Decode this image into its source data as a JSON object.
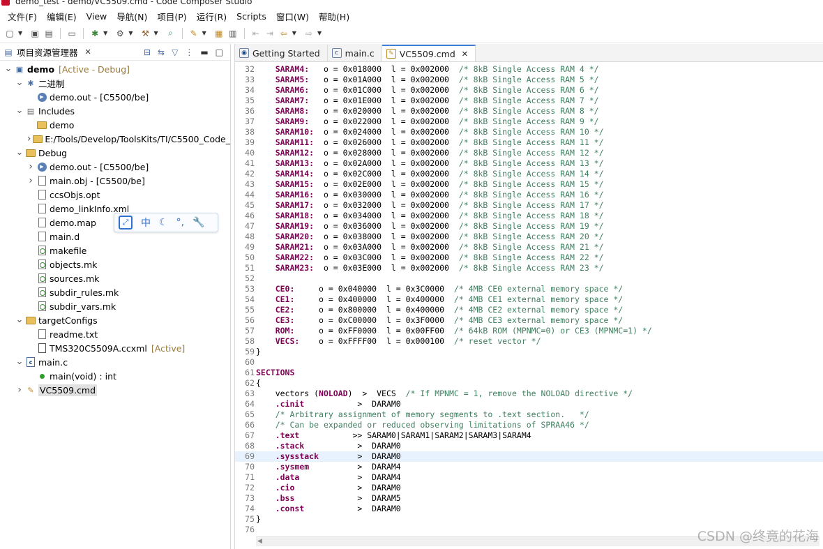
{
  "window": {
    "title": "demo_test - demo/VC5509.cmd - Code Composer Studio"
  },
  "menu": [
    "文件(F)",
    "编辑(E)",
    "View",
    "导航(N)",
    "项目(P)",
    "运行(R)",
    "Scripts",
    "窗口(W)",
    "帮助(H)"
  ],
  "explorer": {
    "title": "项目资源管理器",
    "tree": [
      {
        "label": "demo",
        "decor": "[Active - Debug]",
        "depth": 0,
        "twisty": "down",
        "icon": "project-icon",
        "bold": true
      },
      {
        "label": "二进制",
        "decor": "",
        "depth": 1,
        "twisty": "down",
        "icon": "binaries-icon"
      },
      {
        "label": "demo.out - [C5500/be]",
        "decor": "",
        "depth": 2,
        "twisty": "",
        "icon": "executable-icon"
      },
      {
        "label": "Includes",
        "decor": "",
        "depth": 1,
        "twisty": "down",
        "icon": "includes-icon"
      },
      {
        "label": "demo",
        "decor": "",
        "depth": 2,
        "twisty": "",
        "icon": "include-folder-icon"
      },
      {
        "label": "E:/Tools/Develop/ToolsKits/TI/C5500_Code_",
        "decor": "",
        "depth": 2,
        "twisty": "right",
        "icon": "include-folder-icon"
      },
      {
        "label": "Debug",
        "decor": "",
        "depth": 1,
        "twisty": "down",
        "icon": "folder-icon"
      },
      {
        "label": "demo.out - [C5500/be]",
        "decor": "",
        "depth": 2,
        "twisty": "right",
        "icon": "executable-icon"
      },
      {
        "label": "main.obj - [C5500/be]",
        "decor": "",
        "depth": 2,
        "twisty": "right",
        "icon": "object-file-icon"
      },
      {
        "label": "ccsObjs.opt",
        "decor": "",
        "depth": 2,
        "twisty": "",
        "icon": "file-icon"
      },
      {
        "label": "demo_linkInfo.xml",
        "decor": "",
        "depth": 2,
        "twisty": "",
        "icon": "file-icon"
      },
      {
        "label": "demo.map",
        "decor": "",
        "depth": 2,
        "twisty": "",
        "icon": "file-icon"
      },
      {
        "label": "main.d",
        "decor": "",
        "depth": 2,
        "twisty": "",
        "icon": "file-icon"
      },
      {
        "label": "makefile",
        "decor": "",
        "depth": 2,
        "twisty": "",
        "icon": "makefile-icon"
      },
      {
        "label": "objects.mk",
        "decor": "",
        "depth": 2,
        "twisty": "",
        "icon": "makefile-icon"
      },
      {
        "label": "sources.mk",
        "decor": "",
        "depth": 2,
        "twisty": "",
        "icon": "makefile-icon"
      },
      {
        "label": "subdir_rules.mk",
        "decor": "",
        "depth": 2,
        "twisty": "",
        "icon": "makefile-icon"
      },
      {
        "label": "subdir_vars.mk",
        "decor": "",
        "depth": 2,
        "twisty": "",
        "icon": "makefile-icon"
      },
      {
        "label": "targetConfigs",
        "decor": "",
        "depth": 1,
        "twisty": "down",
        "icon": "folder-icon"
      },
      {
        "label": "readme.txt",
        "decor": "",
        "depth": 2,
        "twisty": "",
        "icon": "file-icon"
      },
      {
        "label": "TMS320C5509A.ccxml",
        "decor": "[Active]",
        "depth": 2,
        "twisty": "",
        "icon": "ccxml-icon"
      },
      {
        "label": "main.c",
        "decor": "",
        "depth": 1,
        "twisty": "down",
        "icon": "c-file-icon"
      },
      {
        "label": "main(void) : int",
        "decor": "",
        "depth": 2,
        "twisty": "",
        "icon": "function-icon"
      },
      {
        "label": "VC5509.cmd",
        "decor": "",
        "depth": 1,
        "twisty": "right",
        "icon": "cmd-file-icon",
        "selected": true
      }
    ]
  },
  "ime": {
    "lang": "中"
  },
  "editor": {
    "tabs": [
      {
        "label": "Getting Started",
        "active": false,
        "closable": false
      },
      {
        "label": "main.c",
        "active": false,
        "closable": false
      },
      {
        "label": "VC5509.cmd",
        "active": true,
        "closable": true
      }
    ],
    "current_line": 69,
    "lines": [
      {
        "n": "32",
        "kw": "SARAM4:",
        "rest": "   o = 0x018000  l = 0x002000  ",
        "cm": "/* 8kB Single Access RAM 4 */"
      },
      {
        "n": "33",
        "kw": "SARAM5:",
        "rest": "   o = 0x01A000  l = 0x002000  ",
        "cm": "/* 8kB Single Access RAM 5 */"
      },
      {
        "n": "34",
        "kw": "SARAM6:",
        "rest": "   o = 0x01C000  l = 0x002000  ",
        "cm": "/* 8kB Single Access RAM 6 */"
      },
      {
        "n": "35",
        "kw": "SARAM7:",
        "rest": "   o = 0x01E000  l = 0x002000  ",
        "cm": "/* 8kB Single Access RAM 7 */"
      },
      {
        "n": "36",
        "kw": "SARAM8:",
        "rest": "   o = 0x020000  l = 0x002000  ",
        "cm": "/* 8kB Single Access RAM 8 */"
      },
      {
        "n": "37",
        "kw": "SARAM9:",
        "rest": "   o = 0x022000  l = 0x002000  ",
        "cm": "/* 8kB Single Access RAM 9 */"
      },
      {
        "n": "38",
        "kw": "SARAM10:",
        "rest": "  o = 0x024000  l = 0x002000  ",
        "cm": "/* 8kB Single Access RAM 10 */"
      },
      {
        "n": "39",
        "kw": "SARAM11:",
        "rest": "  o = 0x026000  l = 0x002000  ",
        "cm": "/* 8kB Single Access RAM 11 */"
      },
      {
        "n": "40",
        "kw": "SARAM12:",
        "rest": "  o = 0x028000  l = 0x002000  ",
        "cm": "/* 8kB Single Access RAM 12 */"
      },
      {
        "n": "41",
        "kw": "SARAM13:",
        "rest": "  o = 0x02A000  l = 0x002000  ",
        "cm": "/* 8kB Single Access RAM 13 */"
      },
      {
        "n": "42",
        "kw": "SARAM14:",
        "rest": "  o = 0x02C000  l = 0x002000  ",
        "cm": "/* 8kB Single Access RAM 14 */"
      },
      {
        "n": "43",
        "kw": "SARAM15:",
        "rest": "  o = 0x02E000  l = 0x002000  ",
        "cm": "/* 8kB Single Access RAM 15 */"
      },
      {
        "n": "44",
        "kw": "SARAM16:",
        "rest": "  o = 0x030000  l = 0x002000  ",
        "cm": "/* 8kB Single Access RAM 16 */"
      },
      {
        "n": "45",
        "kw": "SARAM17:",
        "rest": "  o = 0x032000  l = 0x002000  ",
        "cm": "/* 8kB Single Access RAM 17 */"
      },
      {
        "n": "46",
        "kw": "SARAM18:",
        "rest": "  o = 0x034000  l = 0x002000  ",
        "cm": "/* 8kB Single Access RAM 18 */"
      },
      {
        "n": "47",
        "kw": "SARAM19:",
        "rest": "  o = 0x036000  l = 0x002000  ",
        "cm": "/* 8kB Single Access RAM 19 */"
      },
      {
        "n": "48",
        "kw": "SARAM20:",
        "rest": "  o = 0x038000  l = 0x002000  ",
        "cm": "/* 8kB Single Access RAM 20 */"
      },
      {
        "n": "49",
        "kw": "SARAM21:",
        "rest": "  o = 0x03A000  l = 0x002000  ",
        "cm": "/* 8kB Single Access RAM 21 */"
      },
      {
        "n": "50",
        "kw": "SARAM22:",
        "rest": "  o = 0x03C000  l = 0x002000  ",
        "cm": "/* 8kB Single Access RAM 22 */"
      },
      {
        "n": "51",
        "kw": "SARAM23:",
        "rest": "  o = 0x03E000  l = 0x002000  ",
        "cm": "/* 8kB Single Access RAM 23 */"
      },
      {
        "n": "52",
        "kw": "",
        "rest": "",
        "cm": ""
      },
      {
        "n": "53",
        "kw": "CE0:",
        "rest": "     o = 0x040000  l = 0x3C0000  ",
        "cm": "/* 4MB CE0 external memory space */"
      },
      {
        "n": "54",
        "kw": "CE1:",
        "rest": "     o = 0x400000  l = 0x400000  ",
        "cm": "/* 4MB CE1 external memory space */"
      },
      {
        "n": "55",
        "kw": "CE2:",
        "rest": "     o = 0x800000  l = 0x400000  ",
        "cm": "/* 4MB CE2 external memory space */"
      },
      {
        "n": "56",
        "kw": "CE3:",
        "rest": "     o = 0xC00000  l = 0x3F0000  ",
        "cm": "/* 4MB CE3 external memory space */"
      },
      {
        "n": "57",
        "kw": "ROM:",
        "rest": "     o = 0xFF0000  l = 0x00FF00  ",
        "cm": "/* 64kB ROM (MPNMC=0) or CE3 (MPNMC=1) */"
      },
      {
        "n": "58",
        "kw": "VECS:",
        "rest": "    o = 0xFFFF00  l = 0x000100  ",
        "cm": "/* reset vector */"
      },
      {
        "n": "59",
        "pre": "}",
        "kw": "",
        "rest": "",
        "cm": ""
      },
      {
        "n": "60",
        "kw": "",
        "rest": "",
        "cm": ""
      },
      {
        "n": "61",
        "pre": "SECTIONS",
        "prekw": true,
        "kw": "",
        "rest": "",
        "cm": ""
      },
      {
        "n": "62",
        "pre": "{",
        "kw": "",
        "rest": "",
        "cm": ""
      },
      {
        "n": "63",
        "plain": "vectors (",
        "kw2": "NOLOAD",
        "rest": ")  >  VECS  ",
        "cm": "/* If MPNMC = 1, remove the NOLOAD directive */"
      },
      {
        "n": "64",
        "kw": ".cinit",
        "rest": "           >  DARAM0",
        "cm": ""
      },
      {
        "n": "65",
        "kw": "",
        "rest": "",
        "cm": "/* Arbitrary assignment of memory segments to .text section.   */"
      },
      {
        "n": "66",
        "kw": "",
        "rest": "",
        "cm": "/* Can be expanded or reduced observing limitations of SPRAA46 */"
      },
      {
        "n": "67",
        "kw": ".text",
        "rest": "           >> SARAM0|SARAM1|SARAM2|SARAM3|SARAM4",
        "cm": ""
      },
      {
        "n": "68",
        "kw": ".stack",
        "rest": "           >  DARAM0",
        "cm": ""
      },
      {
        "n": "69",
        "kw": ".sysstack",
        "rest": "        >  DARAM0",
        "cm": ""
      },
      {
        "n": "70",
        "kw": ".sysmem",
        "rest": "          >  DARAM4",
        "cm": ""
      },
      {
        "n": "71",
        "kw": ".data",
        "rest": "            >  DARAM4",
        "cm": ""
      },
      {
        "n": "72",
        "kw": ".cio",
        "rest": "             >  DARAM0",
        "cm": ""
      },
      {
        "n": "73",
        "kw": ".bss",
        "rest": "             >  DARAM5",
        "cm": ""
      },
      {
        "n": "74",
        "kw": ".const",
        "rest": "           >  DARAM0",
        "cm": ""
      },
      {
        "n": "75",
        "pre": "}",
        "kw": "",
        "rest": "",
        "cm": ""
      },
      {
        "n": "76",
        "kw": "",
        "rest": "",
        "cm": ""
      }
    ]
  },
  "watermark": "CSDN @终竟的花海"
}
